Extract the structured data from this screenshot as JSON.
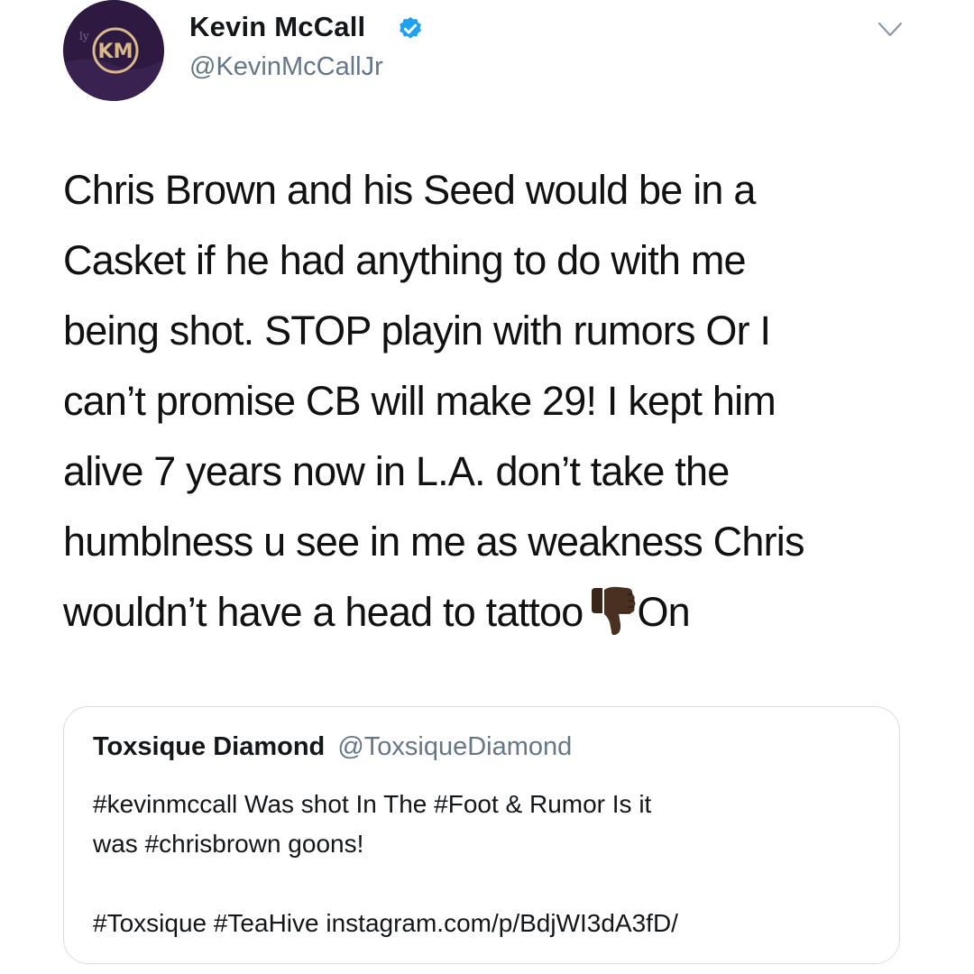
{
  "tweet": {
    "author": {
      "name": "Kevin McCall",
      "handle": "@KevinMcCallJr",
      "verified": true,
      "avatar_logo": "KM",
      "avatar_icon": "km-monogram-logo"
    },
    "menu_icon": "chevron-down-icon",
    "text_lines": [
      "Chris Brown and his Seed would be in a",
      "Casket if he had anything to do with me",
      "being shot. STOP playin with rumors Or I",
      "can’t promise CB will make 29! I kept him",
      "alive 7 years now in L.A. don’t take the",
      "humblness u see in me as weakness Chris",
      "wouldn’t have a head to tattoo"
    ],
    "text_emoji": "thumbs-down-icon",
    "text_tail": "On"
  },
  "quote": {
    "name": "Toxsique Diamond",
    "handle": "@ToxsiqueDiamond",
    "body_lines": [
      "#kevinmccall Was shot In The #Foot & Rumor Is it",
      "was #chrisbrown goons!"
    ],
    "footer": "#Toxsique #TeaHive instagram.com/p/BdjWI3dA3fD/"
  },
  "colors": {
    "verified_blue": "#1da1f2",
    "secondary_text": "#657786",
    "avatar_purple": "#3a2150",
    "logo_gold": "#d8b98a",
    "quote_border": "#d8dde2"
  }
}
